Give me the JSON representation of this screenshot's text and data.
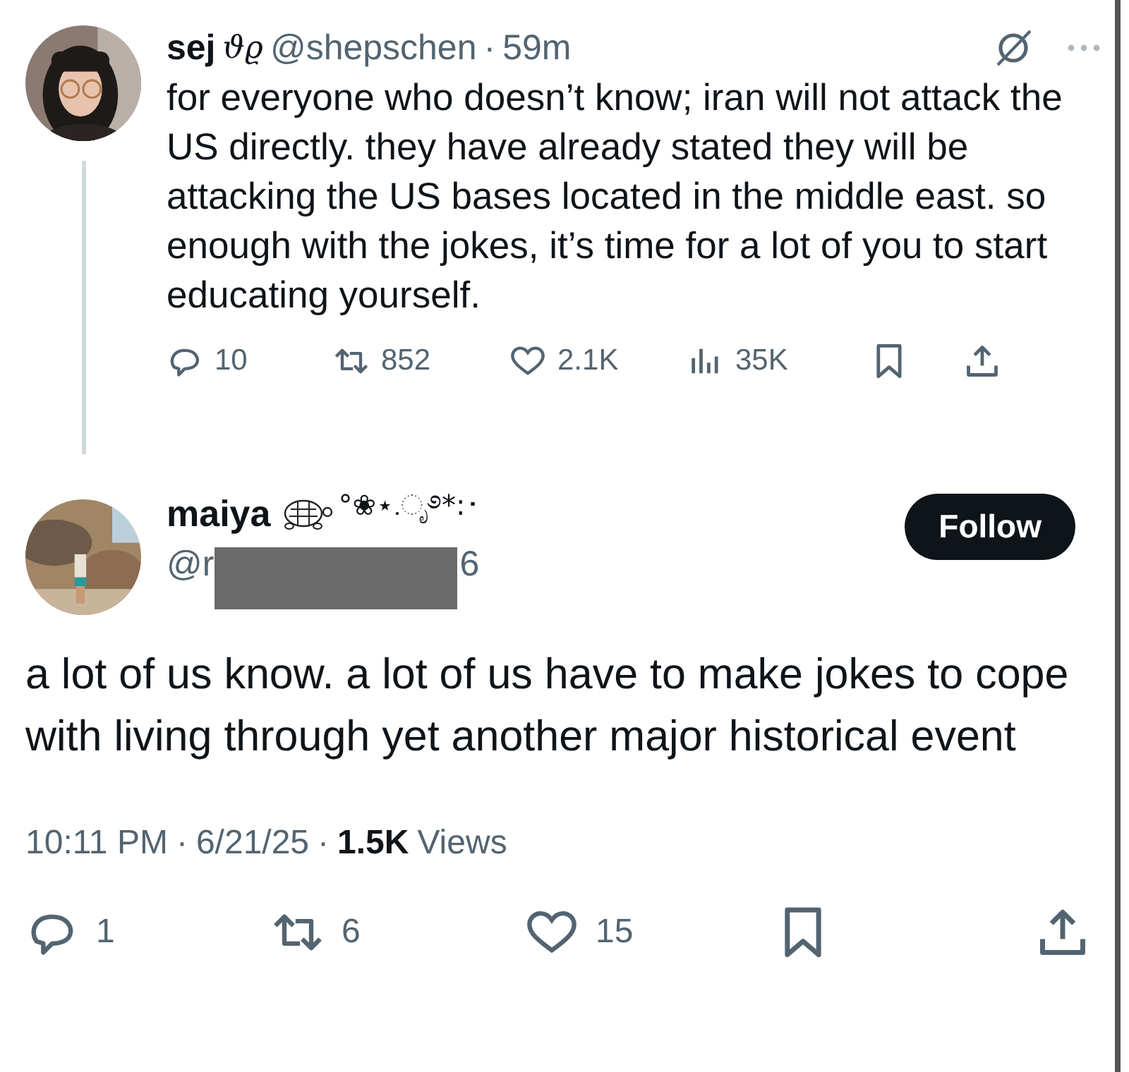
{
  "parent_post": {
    "name": "sej",
    "name_symbols": "ϑϱ",
    "handle": "@shepschen",
    "separator": "·",
    "time": "59m",
    "text": "for everyone who doesn’t know; iran will not attack the US directly. they have already stated they will be attacking the US bases located in the middle east. so enough with the jokes, it’s time for a lot of you to start educating yourself.",
    "actions": [
      {
        "kind": "reply",
        "count": "10"
      },
      {
        "kind": "repost",
        "count": "852"
      },
      {
        "kind": "like",
        "count": "2.1K"
      },
      {
        "kind": "views",
        "count": "35K"
      },
      {
        "kind": "bookmark"
      },
      {
        "kind": "share"
      }
    ]
  },
  "reply_post": {
    "name": "maiya",
    "name_symbols": "°❀⋆.ೃ࿔*:･",
    "handle_start": "@r",
    "handle_end": "6",
    "follow_button": "Follow",
    "text": "a lot of us know. a lot of us have to make jokes to cope with living through yet another major historical event",
    "time": "10:11 PM",
    "separator_1": "·",
    "date": "6/21/25",
    "separator_2": "·",
    "views_count": "1.5K",
    "views_label": "Views",
    "actions": [
      {
        "kind": "reply",
        "count": "1"
      },
      {
        "kind": "repost",
        "count": "6"
      },
      {
        "kind": "like",
        "count": "15"
      },
      {
        "kind": "bookmark"
      },
      {
        "kind": "share"
      }
    ]
  }
}
